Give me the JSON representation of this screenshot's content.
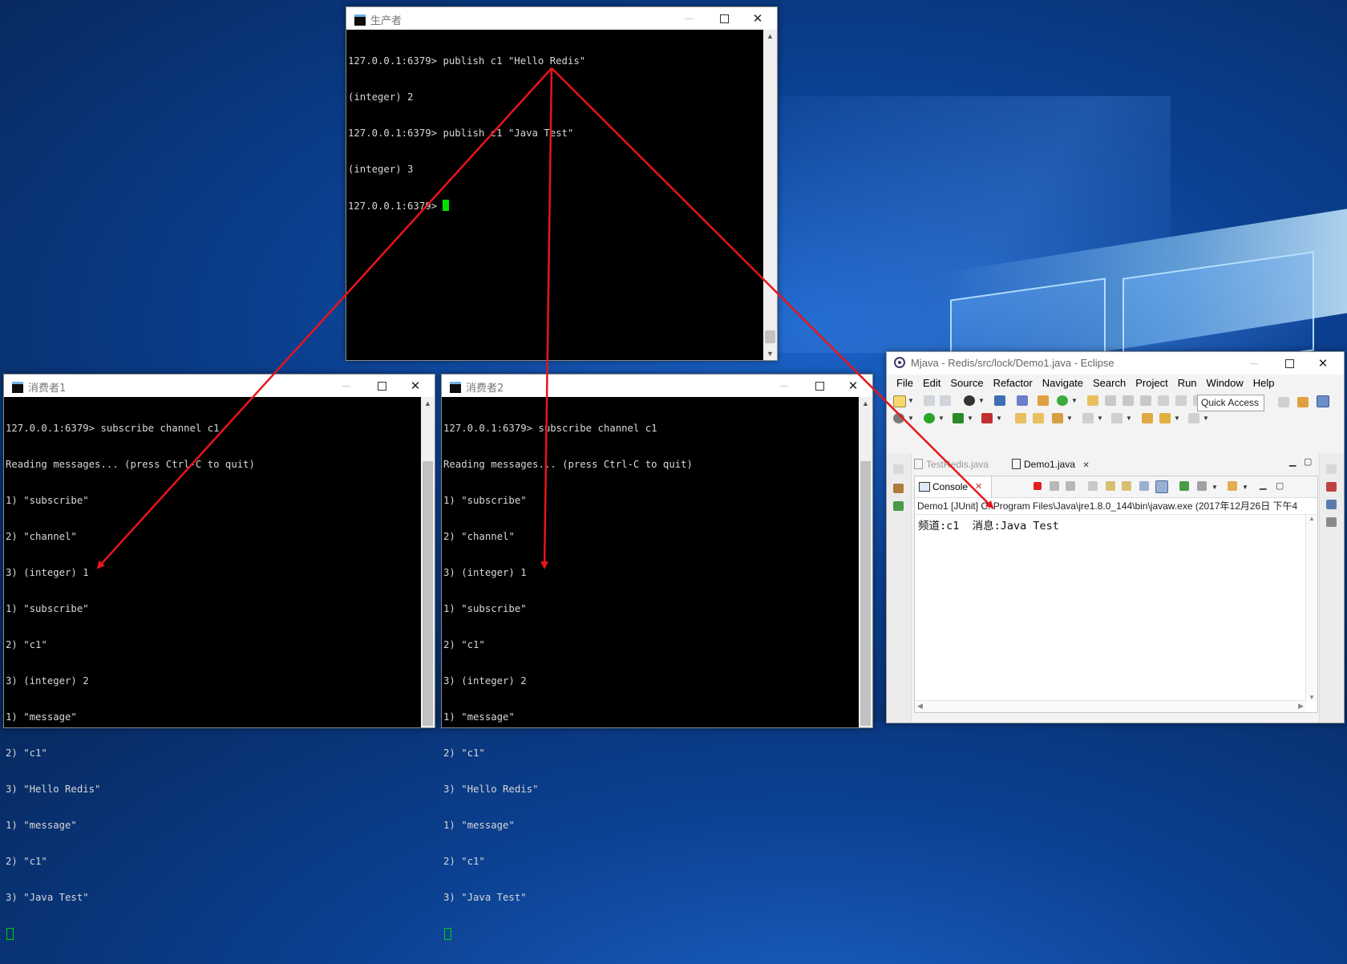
{
  "producer": {
    "title": "生产者",
    "lines": [
      "127.0.0.1:6379> publish c1 \"Hello Redis\"",
      "(integer) 2",
      "127.0.0.1:6379> publish c1 \"Java Test\"",
      "(integer) 3",
      "127.0.0.1:6379> "
    ]
  },
  "consumer1": {
    "title": "消费者1",
    "lines": [
      "127.0.0.1:6379> subscribe channel c1",
      "Reading messages... (press Ctrl-C to quit)",
      "1) \"subscribe\"",
      "2) \"channel\"",
      "3) (integer) 1",
      "1) \"subscribe\"",
      "2) \"c1\"",
      "3) (integer) 2",
      "1) \"message\"",
      "2) \"c1\"",
      "3) \"Hello Redis\"",
      "1) \"message\"",
      "2) \"c1\"",
      "3) \"Java Test\""
    ]
  },
  "consumer2": {
    "title": "消费者2",
    "lines": [
      "127.0.0.1:6379> subscribe channel c1",
      "Reading messages... (press Ctrl-C to quit)",
      "1) \"subscribe\"",
      "2) \"channel\"",
      "3) (integer) 1",
      "1) \"subscribe\"",
      "2) \"c1\"",
      "3) (integer) 2",
      "1) \"message\"",
      "2) \"c1\"",
      "3) \"Hello Redis\"",
      "1) \"message\"",
      "2) \"c1\"",
      "3) \"Java Test\""
    ]
  },
  "window_controls": {
    "close": "✕"
  },
  "eclipse": {
    "title": "Mjava - Redis/src/lock/Demo1.java - Eclipse",
    "menu": [
      "File",
      "Edit",
      "Source",
      "Refactor",
      "Navigate",
      "Search",
      "Project",
      "Run",
      "Window",
      "Help"
    ],
    "quick_access": "Quick Access",
    "editor_tabs": [
      {
        "label": "TestRedis.java"
      },
      {
        "label": "Demo1.java",
        "close": "✕"
      }
    ],
    "console_tab": "Console",
    "console_close": "✕",
    "console_description": "Demo1 [JUnit] C:\\Program Files\\Java\\jre1.8.0_144\\bin\\javaw.exe (2017年12月26日 下午4",
    "console_output": "频道:c1  消息:Java Test"
  },
  "colors": {
    "annotation_arrow": "#e8141b",
    "terminal_bg": "#000000",
    "terminal_fg": "#d7d7d7",
    "cursor": "#00e000"
  }
}
